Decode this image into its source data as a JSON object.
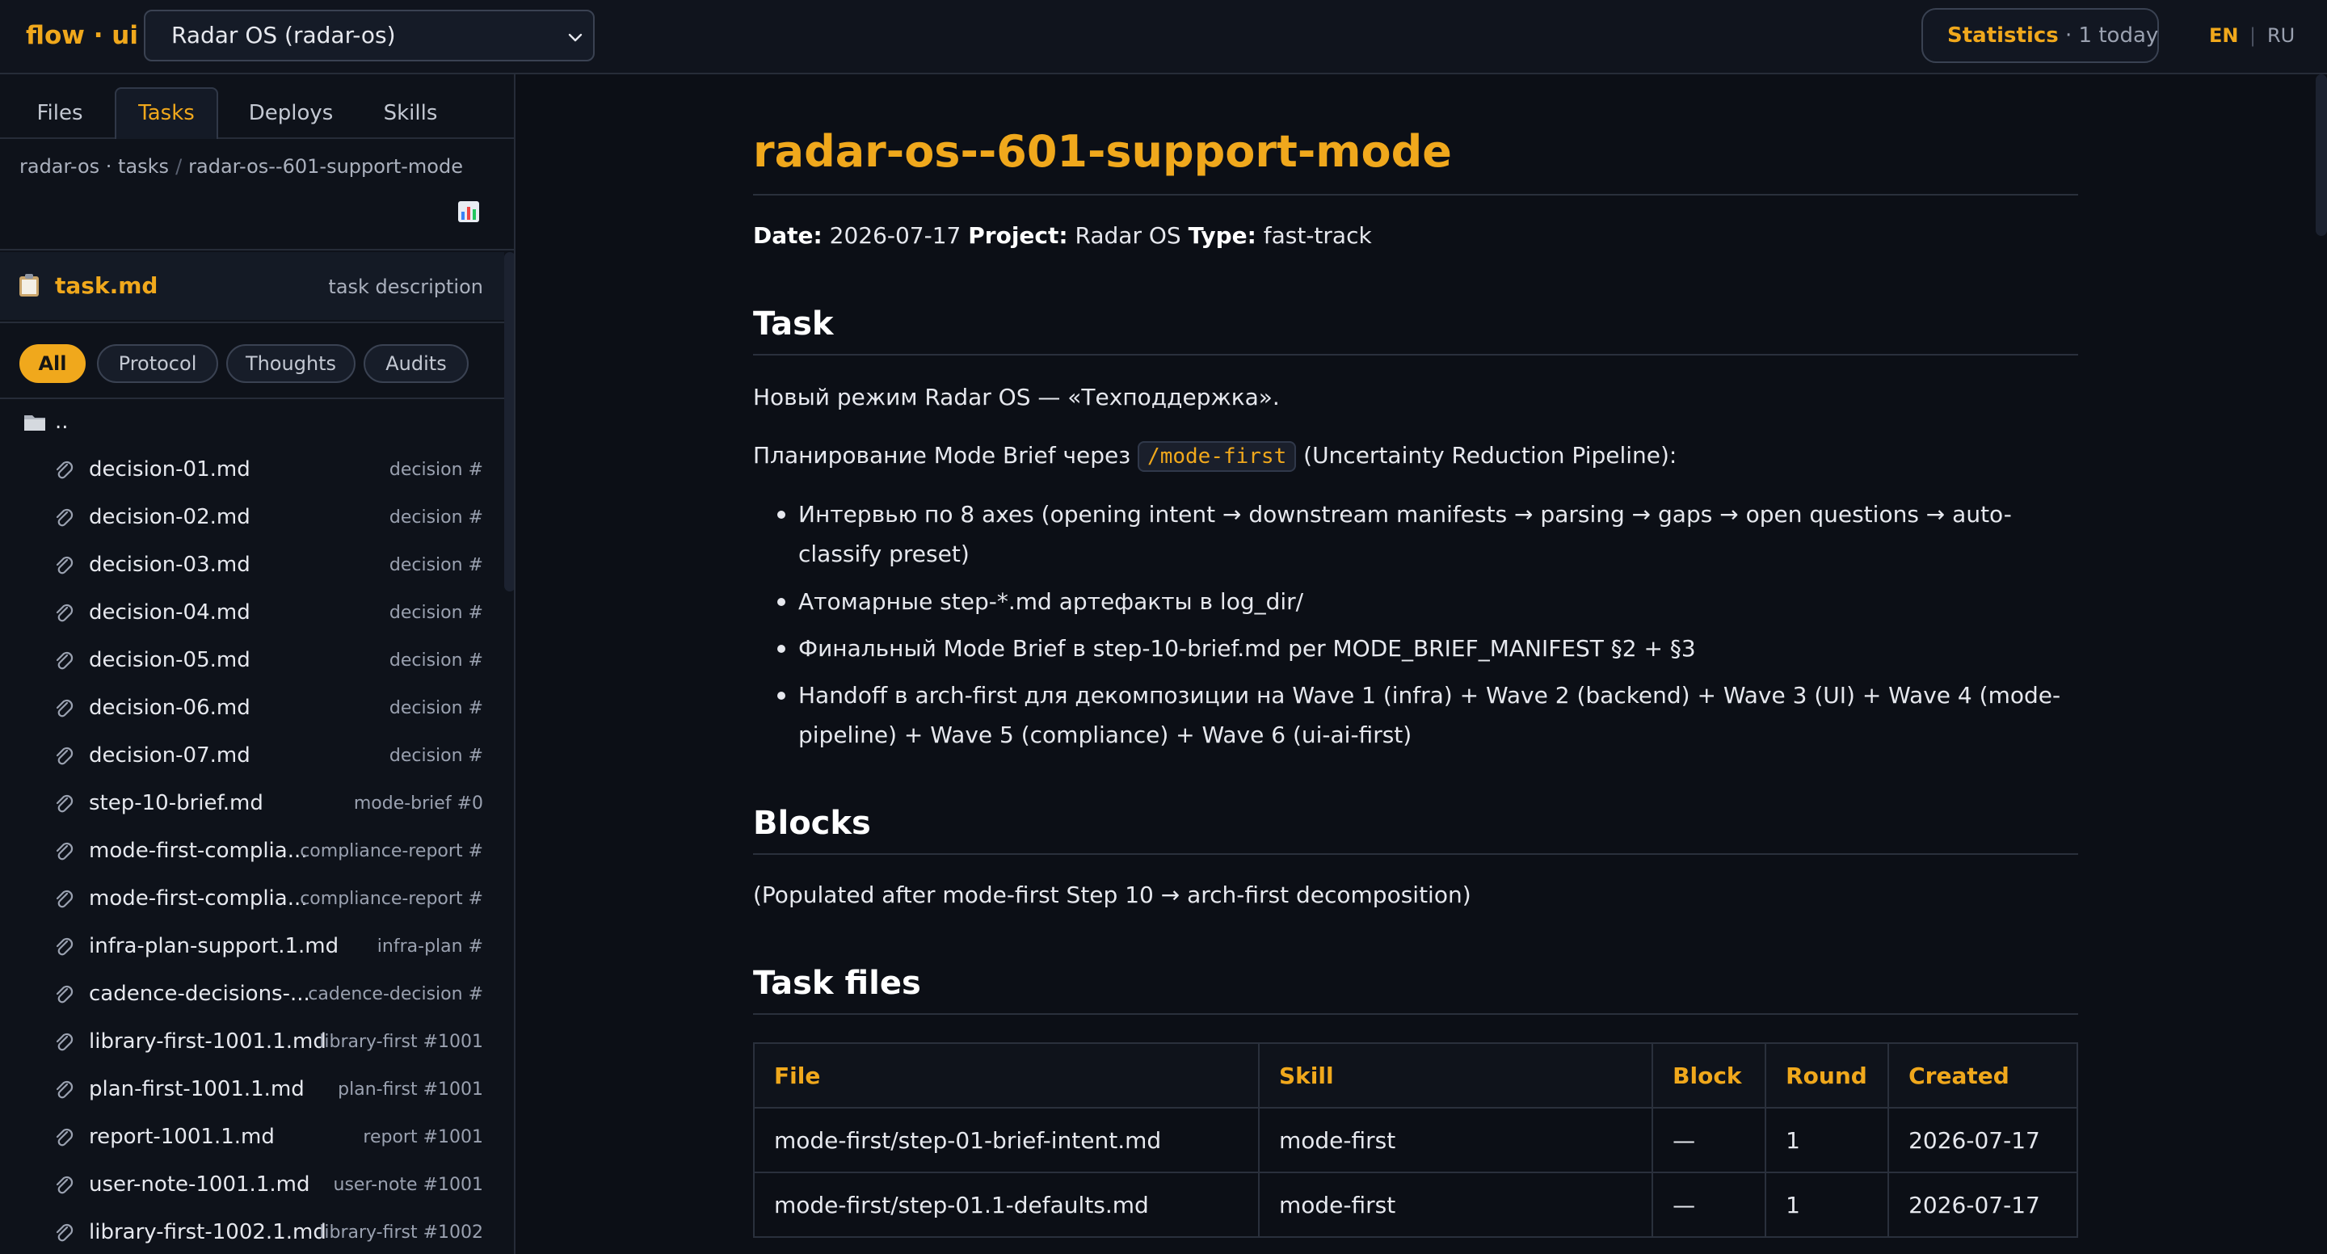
{
  "app": {
    "logo": "flow · ui",
    "project_select": "Radar OS (radar-os)",
    "stats": {
      "label": "Statistics",
      "count": "· 1 today"
    },
    "lang": {
      "en": "EN",
      "sep": "|",
      "ru": "RU"
    }
  },
  "sidebar": {
    "tabs": [
      "Files",
      "Tasks",
      "Deploys",
      "Skills"
    ],
    "active_tab": "Tasks",
    "breadcrumb": {
      "root": "radar-os · tasks",
      "sep": "/",
      "current": "radar-os--601-support-mode"
    },
    "task_file": {
      "name": "task.md",
      "desc": "task description"
    },
    "filters": [
      "All",
      "Protocol",
      "Thoughts",
      "Audits"
    ],
    "active_filter": "All",
    "parent_dir": "..",
    "files": [
      {
        "name": "decision-01.md",
        "tag": "decision #"
      },
      {
        "name": "decision-02.md",
        "tag": "decision #"
      },
      {
        "name": "decision-03.md",
        "tag": "decision #"
      },
      {
        "name": "decision-04.md",
        "tag": "decision #"
      },
      {
        "name": "decision-05.md",
        "tag": "decision #"
      },
      {
        "name": "decision-06.md",
        "tag": "decision #"
      },
      {
        "name": "decision-07.md",
        "tag": "decision #"
      },
      {
        "name": "step-10-brief.md",
        "tag": "mode-brief #0"
      },
      {
        "name": "mode-first-complia...",
        "tag": "compliance-report #"
      },
      {
        "name": "mode-first-complia...",
        "tag": "compliance-report #"
      },
      {
        "name": "infra-plan-support.1.md",
        "tag": "infra-plan #"
      },
      {
        "name": "cadence-decisions-...",
        "tag": "cadence-decision #"
      },
      {
        "name": "library-first-1001.1.md",
        "tag": "library-first #1001"
      },
      {
        "name": "plan-first-1001.1.md",
        "tag": "plan-first #1001"
      },
      {
        "name": "report-1001.1.md",
        "tag": "report #1001"
      },
      {
        "name": "user-note-1001.1.md",
        "tag": "user-note #1001"
      },
      {
        "name": "library-first-1002.1.md",
        "tag": "library-first #1002"
      }
    ]
  },
  "doc": {
    "title": "radar-os--601-support-mode",
    "meta": {
      "date_label": "Date:",
      "date": "2026-07-17",
      "project_label": "Project:",
      "project": "Radar OS",
      "type_label": "Type:",
      "type": "fast-track"
    },
    "task_heading": "Task",
    "task_intro": "Новый режим Radar OS — «Техподдержка».",
    "plan_prefix": "Планирование Mode Brief через",
    "plan_code": "/mode-first",
    "plan_suffix": "(Uncertainty Reduction Pipeline):",
    "bullets": [
      "Интервью по 8 axes (opening intent → downstream manifests → parsing → gaps → open questions → auto-classify preset)",
      "Атомарные step-*.md артефакты в log_dir/",
      "Финальный Mode Brief в step-10-brief.md per MODE_BRIEF_MANIFEST §2 + §3",
      "Handoff в arch-first для декомпозиции на Wave 1 (infra) + Wave 2 (backend) + Wave 3 (UI) + Wave 4 (mode-pipeline) + Wave 5 (compliance) + Wave 6 (ui-ai-first)"
    ],
    "blocks_heading": "Blocks",
    "blocks_text": "(Populated after mode-first Step 10 → arch-first decomposition)",
    "files_heading": "Task files",
    "table": {
      "headers": [
        "File",
        "Skill",
        "Block",
        "Round",
        "Created"
      ],
      "rows": [
        [
          "mode-first/step-01-brief-intent.md",
          "mode-first",
          "—",
          "1",
          "2026-07-17"
        ],
        [
          "mode-first/step-01.1-defaults.md",
          "mode-first",
          "—",
          "1",
          "2026-07-17"
        ]
      ]
    }
  },
  "colors": {
    "accent": "#f0a81c",
    "background": "#0c0f16",
    "sidebar": "#0e121a"
  }
}
